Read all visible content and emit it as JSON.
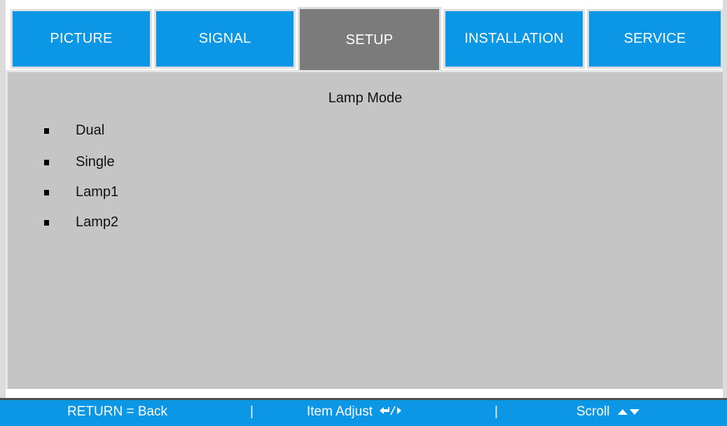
{
  "tabs": [
    {
      "label": "PICTURE",
      "active": false
    },
    {
      "label": "SIGNAL",
      "active": false
    },
    {
      "label": "SETUP",
      "active": true
    },
    {
      "label": "INSTALLATION",
      "active": false
    },
    {
      "label": "SERVICE",
      "active": false
    }
  ],
  "panel": {
    "title": "Lamp Mode",
    "options": [
      "Dual",
      "Single",
      "Lamp1",
      "Lamp2"
    ]
  },
  "footer": {
    "return_label": "RETURN = Back",
    "separator": "|",
    "adjust_label": "Item Adjust",
    "scroll_label": "Scroll"
  },
  "colors": {
    "tab_blue": "#0b96e6",
    "tab_active_gray": "#7b7b7b",
    "panel_gray": "#c5c5c5"
  }
}
